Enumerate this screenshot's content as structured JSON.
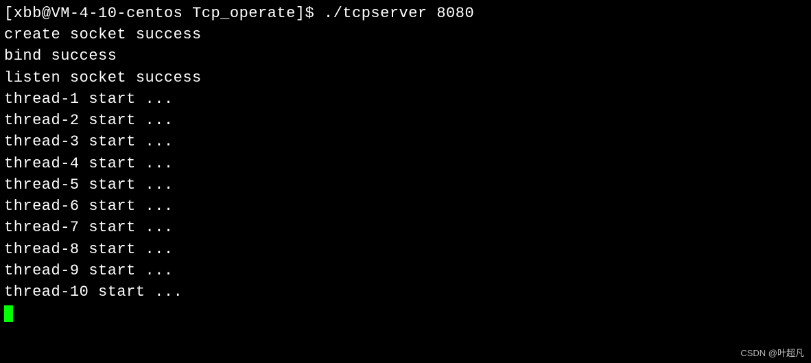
{
  "prompt": {
    "user": "xbb",
    "host": "VM-4-10-centos",
    "cwd": "Tcp_operate",
    "symbol": "$",
    "command": "./tcpserver 8080"
  },
  "output_lines": [
    "create socket success",
    "bind success",
    "listen socket success",
    "thread-1 start ...",
    "thread-2 start ...",
    "thread-3 start ...",
    "thread-4 start ...",
    "thread-5 start ...",
    "thread-6 start ...",
    "thread-7 start ...",
    "thread-8 start ...",
    "thread-9 start ...",
    "thread-10 start ..."
  ],
  "watermark": "CSDN @叶超凡"
}
